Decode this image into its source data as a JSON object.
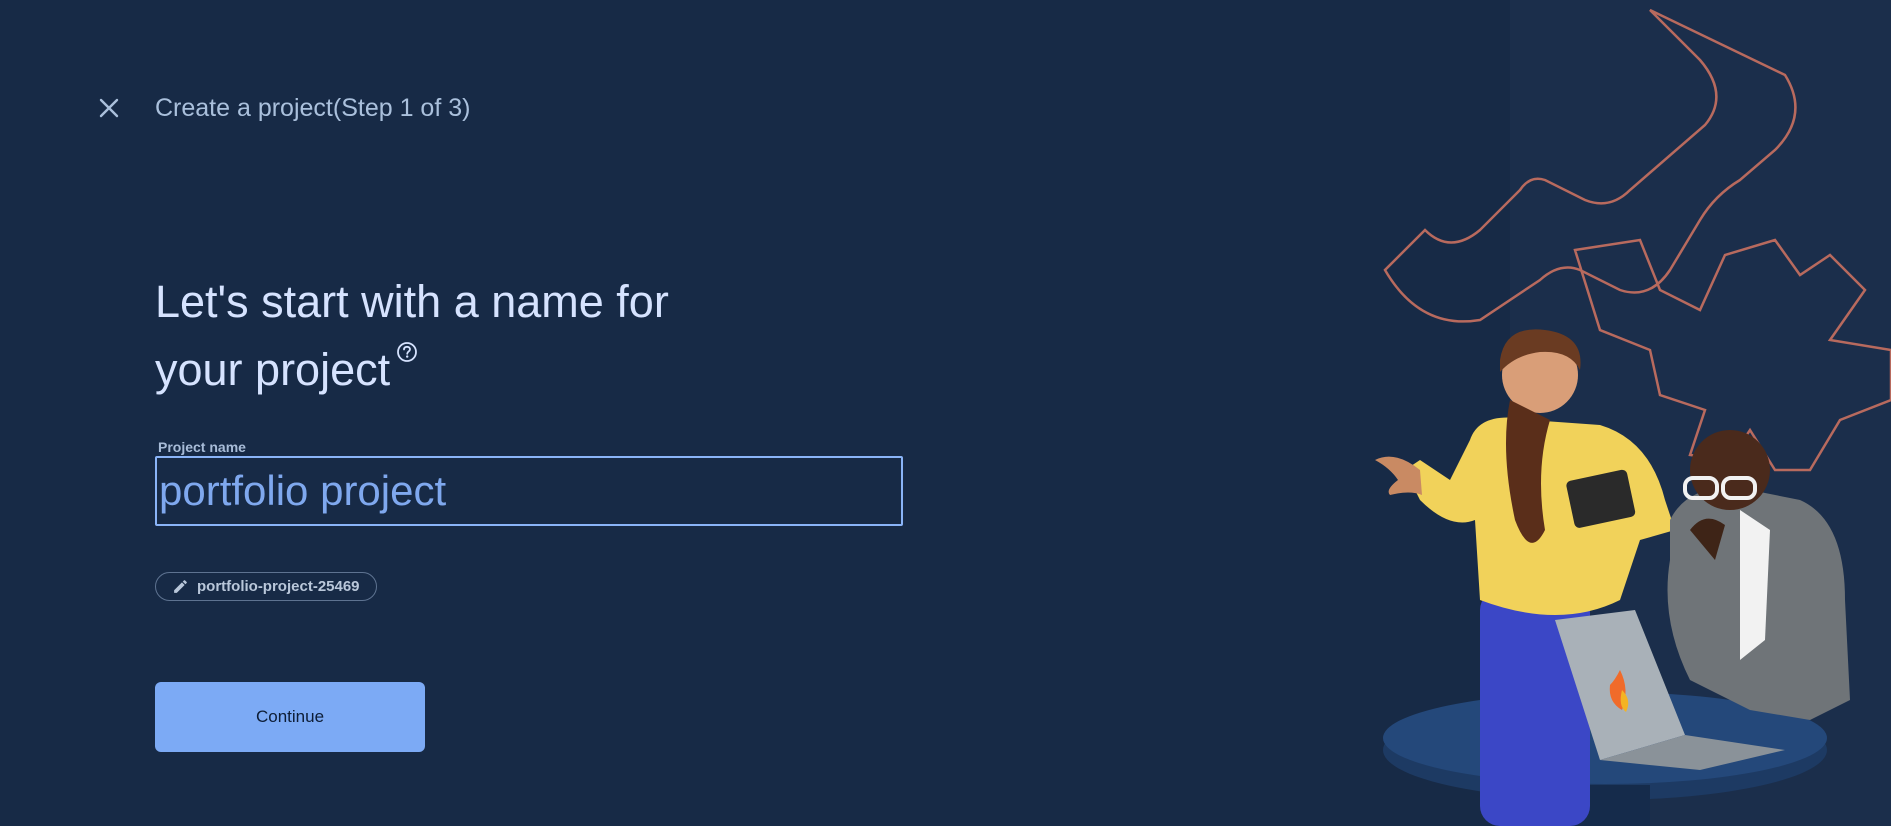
{
  "header": {
    "title": "Create a project(Step 1 of 3)"
  },
  "main": {
    "headline_line1": "Let's start with a name for",
    "headline_line2": "your project",
    "field_label": "Project name",
    "project_name_value": "portfolio project",
    "project_id": "portfolio-project-25469",
    "continue_label": "Continue"
  },
  "icons": {
    "close": "close-icon",
    "help": "help-circle-icon",
    "edit": "pencil-icon"
  },
  "colors": {
    "background": "#172a46",
    "accent": "#7caaf5",
    "input_border": "#8ab4f8",
    "illustration_outline": "#b86a5e"
  }
}
